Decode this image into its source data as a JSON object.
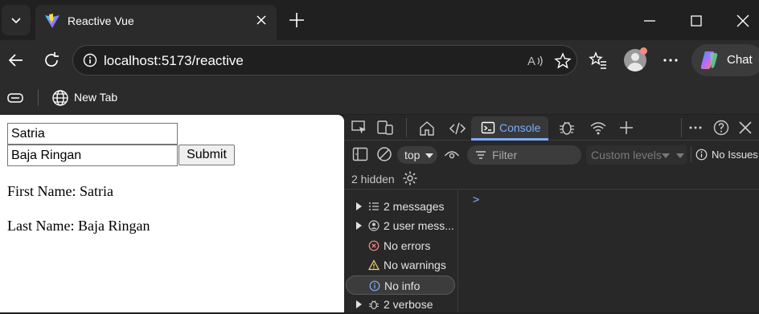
{
  "browser": {
    "tab": {
      "title": "Reactive Vue"
    },
    "address": {
      "url": "localhost:5173/reactive"
    },
    "copilot": {
      "label": "Chat"
    },
    "favorites": [
      {
        "label": "New Tab"
      }
    ],
    "colors": {
      "accent": "#7cacf8",
      "chrome_bg": "#202020",
      "toolbar_bg": "#2b2b2b"
    }
  },
  "page": {
    "first_name_value": "Satria",
    "last_name_value": "Baja Ringan",
    "submit_label": "Submit",
    "first_name_line": "First Name: Satria",
    "last_name_line": "Last Name: Baja Ringan"
  },
  "devtools": {
    "active_tab": "Console",
    "context": "top",
    "filter_placeholder": "Filter",
    "levels": "Custom levels",
    "issues": "No Issues",
    "hidden": "2 hidden",
    "sidebar": [
      {
        "label": "2 messages",
        "icon": "list-icon",
        "expandable": true
      },
      {
        "label": "2 user mess...",
        "icon": "user-icon",
        "expandable": true
      },
      {
        "label": "No errors",
        "icon": "error-icon",
        "expandable": false
      },
      {
        "label": "No warnings",
        "icon": "warning-icon",
        "expandable": false
      },
      {
        "label": "No info",
        "icon": "info-icon",
        "expandable": false,
        "selected": true
      },
      {
        "label": "2 verbose",
        "icon": "bug-icon",
        "expandable": true
      }
    ],
    "prompt": ">"
  }
}
